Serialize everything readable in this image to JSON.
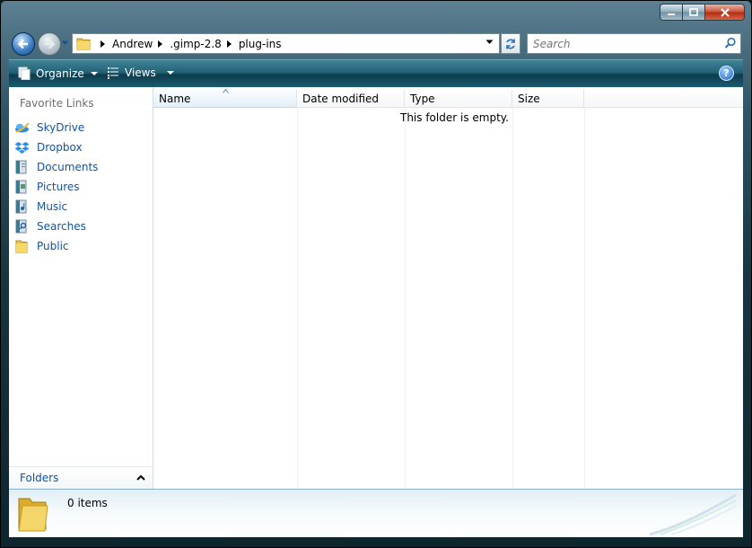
{
  "window": {
    "caption_buttons": [
      "minimize-icon",
      "maximize-icon",
      "close-icon"
    ]
  },
  "address": {
    "breadcrumbs": [
      "Andrew",
      ".gimp-2.8",
      "plug-ins"
    ]
  },
  "search": {
    "placeholder": "Search"
  },
  "toolbar": {
    "organize_label": "Organize",
    "views_label": "Views",
    "help_label": "?"
  },
  "sidebar": {
    "favorites_title": "Favorite Links",
    "items": [
      {
        "label": "SkyDrive",
        "icon": "skydrive-icon"
      },
      {
        "label": "Dropbox",
        "icon": "dropbox-icon"
      },
      {
        "label": "Documents",
        "icon": "documents-icon"
      },
      {
        "label": "Pictures",
        "icon": "pictures-icon"
      },
      {
        "label": "Music",
        "icon": "music-icon"
      },
      {
        "label": "Searches",
        "icon": "searches-icon"
      },
      {
        "label": "Public",
        "icon": "public-folder-icon"
      }
    ],
    "folders_label": "Folders"
  },
  "file_list": {
    "columns": [
      "Name",
      "Date modified",
      "Type",
      "Size"
    ],
    "sorted_column": "Name",
    "empty_message": "This folder is empty."
  },
  "details_pane": {
    "item_count": "0 items"
  },
  "colors": {
    "link_blue": "#0b55a6",
    "toolbar_teal": "#236276",
    "frame_dark": "#18353f"
  }
}
